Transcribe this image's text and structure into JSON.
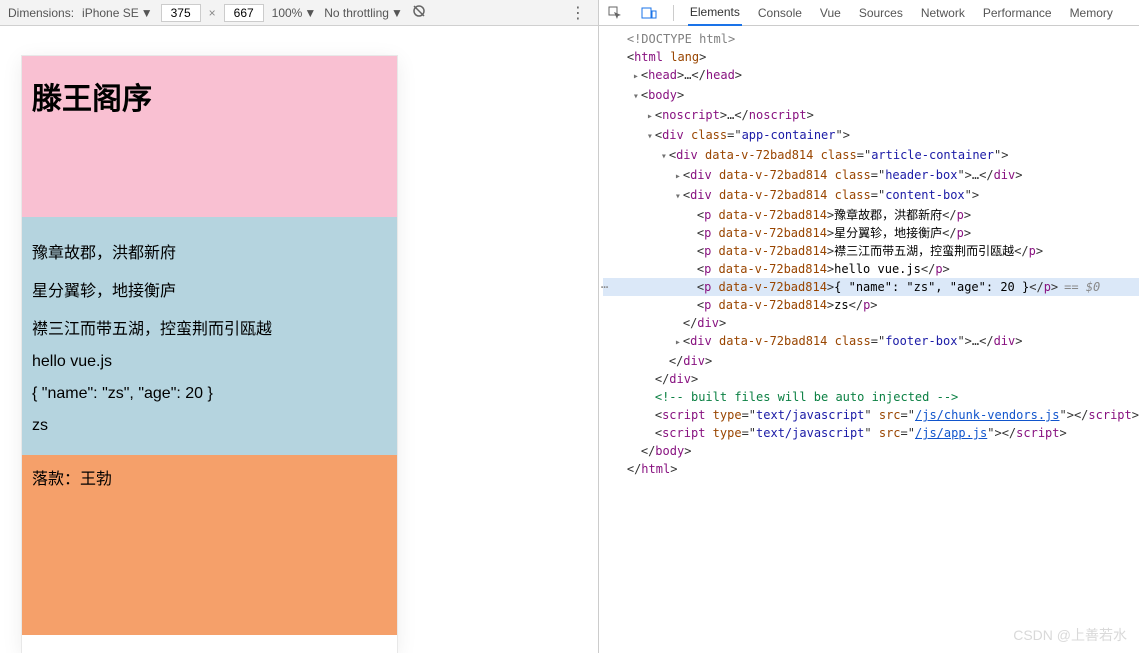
{
  "deviceToolbar": {
    "dimLabel": "Dimensions:",
    "device": "iPhone SE",
    "width": "375",
    "height": "667",
    "zoom": "100%",
    "throttling": "No throttling"
  },
  "devtoolsTabs": {
    "elements": "Elements",
    "console": "Console",
    "vue": "Vue",
    "sources": "Sources",
    "network": "Network",
    "performance": "Performance",
    "memory": "Memory"
  },
  "preview": {
    "title": "滕王阁序",
    "paragraphs": [
      "豫章故郡，洪都新府",
      "星分翼轸，地接衡庐",
      "襟三江而带五湖，控蛮荆而引瓯越",
      "hello vue.js",
      "{ \"name\": \"zs\", \"age\": 20 }",
      "zs"
    ],
    "footer": "落款：王勃"
  },
  "tree": {
    "doctype": "<!DOCTYPE html>",
    "htmlOpen": "html",
    "htmlLang": "lang",
    "head": "head",
    "body": "body",
    "noscript": "noscript",
    "div": "div",
    "p": "p",
    "script": "script",
    "classAttr": "class",
    "dataV": "data-v-72bad814",
    "typeAttr": "type",
    "srcAttr": "src",
    "appContainer": "app-container",
    "articleContainer": "article-container",
    "headerBox": "header-box",
    "contentBox": "content-box",
    "footerBox": "footer-box",
    "p1": "豫章故郡，洪都新府",
    "p2": "星分翼轸，地接衡庐",
    "p3": "襟三江而带五湖，控蛮荆而引瓯越",
    "p4": "hello vue.js",
    "p5": "{ \"name\": \"zs\", \"age\": 20 }",
    "p6": "zs",
    "selHint": "== $0",
    "comment": "<!-- built files will be auto injected -->",
    "textjs": "text/javascript",
    "chunk": "/js/chunk-vendors.js",
    "app": "/js/app.js"
  },
  "watermark": "CSDN @上善若水"
}
